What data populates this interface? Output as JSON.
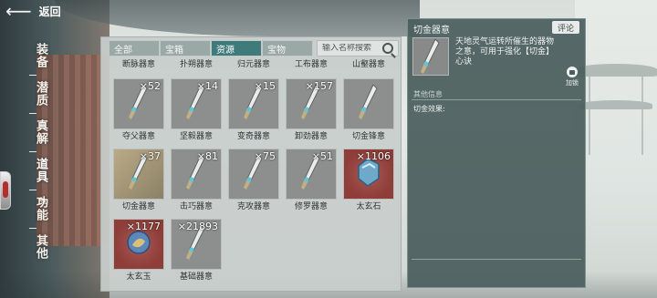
{
  "top": {
    "back_label": "返回"
  },
  "nav": {
    "items": [
      {
        "id": "equip",
        "label": "装备",
        "active": false
      },
      {
        "id": "potential",
        "label": "潜质",
        "active": false
      },
      {
        "id": "truth",
        "label": "真解",
        "active": false
      },
      {
        "id": "props",
        "label": "道具",
        "active": true
      },
      {
        "id": "skill",
        "label": "功能",
        "active": false
      },
      {
        "id": "other",
        "label": "其他",
        "active": false
      }
    ]
  },
  "inventory": {
    "tabs": [
      {
        "label": "全部",
        "active": false
      },
      {
        "label": "宝箱",
        "active": false
      },
      {
        "label": "资源",
        "active": true
      },
      {
        "label": "宝物",
        "active": false
      }
    ],
    "search": {
      "placeholder": "输入名称搜索"
    },
    "partial_row": [
      "断脉器意",
      "扑朔器意",
      "归元器意",
      "工布器意",
      "山壑器意"
    ],
    "items": [
      {
        "name": "夺父器意",
        "count": "×52",
        "icon": "blade-icon",
        "frame": "gray"
      },
      {
        "name": "坚毅器意",
        "count": "×14",
        "icon": "blade-icon",
        "frame": "gray"
      },
      {
        "name": "变奇器意",
        "count": "×15",
        "icon": "blade-icon",
        "frame": "gray"
      },
      {
        "name": "卸劲器意",
        "count": "×157",
        "icon": "blade-icon",
        "frame": "gray"
      },
      {
        "name": "切金锋意",
        "count": "",
        "icon": "blade-icon",
        "frame": "gray"
      },
      {
        "name": "切金器意",
        "count": "×37",
        "icon": "blade-icon",
        "frame": "gold"
      },
      {
        "name": "击巧器意",
        "count": "×81",
        "icon": "blade-icon",
        "frame": "gray"
      },
      {
        "name": "克攻器意",
        "count": "×75",
        "icon": "blade-icon",
        "frame": "gray"
      },
      {
        "name": "修罗器意",
        "count": "×51",
        "icon": "blade-icon",
        "frame": "gray"
      },
      {
        "name": "太玄石",
        "count": "×1106",
        "icon": "stone-icon",
        "frame": "red"
      },
      {
        "name": "太玄玉",
        "count": "×1177",
        "icon": "jade-icon",
        "frame": "red"
      },
      {
        "name": "基础器意",
        "count": "×21893",
        "icon": "blade-icon",
        "frame": "gray"
      }
    ]
  },
  "detail": {
    "title": "切金器意",
    "comment_label": "评论",
    "description": "天地灵气运转所催生的器物之意，可用于强化【切金】心诀",
    "lock_label": "加锁",
    "other_info_label": "其他信息",
    "effect_label": "切金效果:"
  },
  "colors": {
    "tab_active": "#3f7b7a",
    "tab_inactive": "#9aa8a6",
    "detail_bg": "#4a5e5c",
    "item_frame_gold": "#b9ab86",
    "item_frame_red": "#a95b55"
  }
}
